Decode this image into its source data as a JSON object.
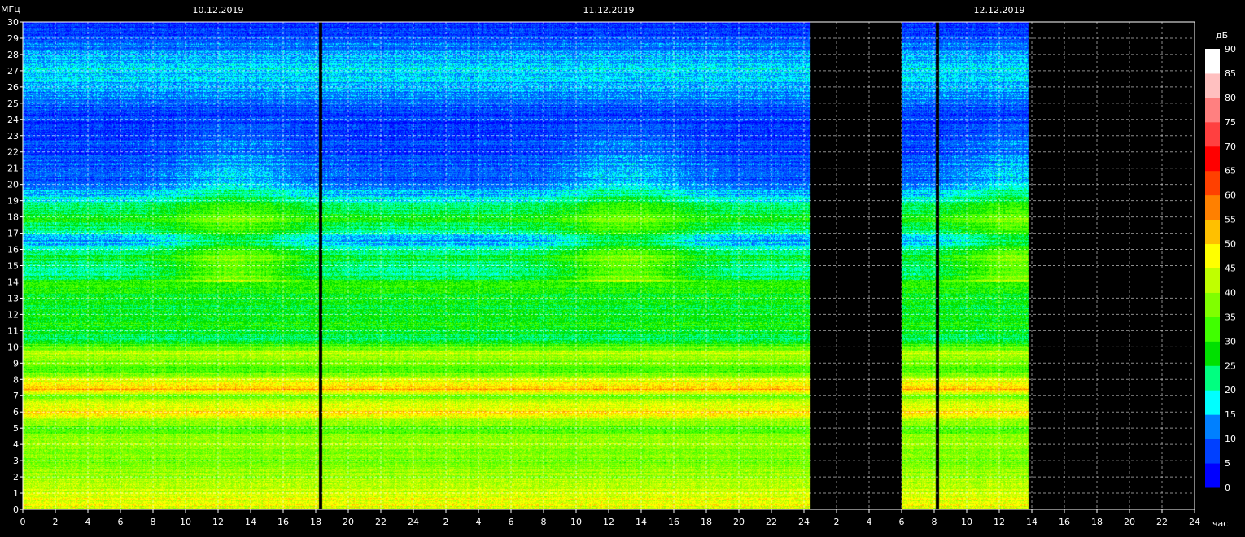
{
  "chart_data": {
    "type": "heatmap",
    "title": "",
    "ylabel": "МГц",
    "xlabel": "час",
    "ylim": [
      0,
      30
    ],
    "yticks": [
      "0",
      "1",
      "2",
      "3",
      "4",
      "5",
      "6",
      "7",
      "8",
      "9",
      "10",
      "11",
      "12",
      "13",
      "14",
      "15",
      "16",
      "17",
      "18",
      "19",
      "20",
      "21",
      "22",
      "23",
      "24",
      "25",
      "26",
      "27",
      "28",
      "29",
      "30"
    ],
    "x_range_hours": [
      0,
      72
    ],
    "xticks": [
      "0",
      "2",
      "4",
      "6",
      "8",
      "10",
      "12",
      "14",
      "16",
      "18",
      "20",
      "22",
      "24",
      "2",
      "4",
      "6",
      "8",
      "10",
      "12",
      "14",
      "16",
      "18",
      "20",
      "22",
      "24",
      "2",
      "4",
      "6",
      "8",
      "10",
      "12",
      "14",
      "16",
      "18",
      "20",
      "22",
      "24"
    ],
    "dates": [
      {
        "label": "10.12.2019",
        "hour": 12
      },
      {
        "label": "11.12.2019",
        "hour": 36
      },
      {
        "label": "12.12.2019",
        "hour": 60
      }
    ],
    "grid": true,
    "colorbar": {
      "label": "дБ",
      "ticks": [
        "0",
        "5",
        "10",
        "15",
        "20",
        "25",
        "30",
        "35",
        "40",
        "45",
        "50",
        "55",
        "60",
        "65",
        "70",
        "75",
        "80",
        "85",
        "90"
      ],
      "colors": [
        "#0000ff",
        "#0040ff",
        "#0080ff",
        "#00ffff",
        "#00ff80",
        "#00e000",
        "#40ff00",
        "#80ff00",
        "#c0ff00",
        "#ffff00",
        "#ffc000",
        "#ff8000",
        "#ff4000",
        "#ff0000",
        "#ff4040",
        "#ff8080",
        "#ffc0c0",
        "#ffffff"
      ]
    },
    "recorded_intervals_hours": [
      [
        0,
        18.2
      ],
      [
        18.4,
        48.4
      ],
      [
        54,
        56.1
      ],
      [
        56.3,
        61.8
      ]
    ],
    "no_data_intervals_hours": [
      [
        48.4,
        54
      ],
      [
        61.8,
        72
      ]
    ],
    "level_profile_by_mhz": [
      {
        "mhz": 0.5,
        "db": 45
      },
      {
        "mhz": 1.5,
        "db": 42
      },
      {
        "mhz": 3,
        "db": 36
      },
      {
        "mhz": 4,
        "db": 40
      },
      {
        "mhz": 5,
        "db": 34
      },
      {
        "mhz": 6,
        "db": 50
      },
      {
        "mhz": 7,
        "db": 36
      },
      {
        "mhz": 7.4,
        "db": 55
      },
      {
        "mhz": 8.5,
        "db": 32
      },
      {
        "mhz": 9.6,
        "db": 42
      },
      {
        "mhz": 10.5,
        "db": 24
      },
      {
        "mhz": 11.5,
        "db": 30
      },
      {
        "mhz": 12.5,
        "db": 26
      },
      {
        "mhz": 13.7,
        "db": 30
      },
      {
        "mhz": 14.8,
        "db": 20
      },
      {
        "mhz": 15.5,
        "db": 26
      },
      {
        "mhz": 16.5,
        "db": 14
      },
      {
        "mhz": 17.8,
        "db": 28
      },
      {
        "mhz": 20,
        "db": 10
      },
      {
        "mhz": 24,
        "db": 6
      },
      {
        "mhz": 27,
        "db": 18
      },
      {
        "mhz": 30,
        "db": 4
      }
    ]
  }
}
